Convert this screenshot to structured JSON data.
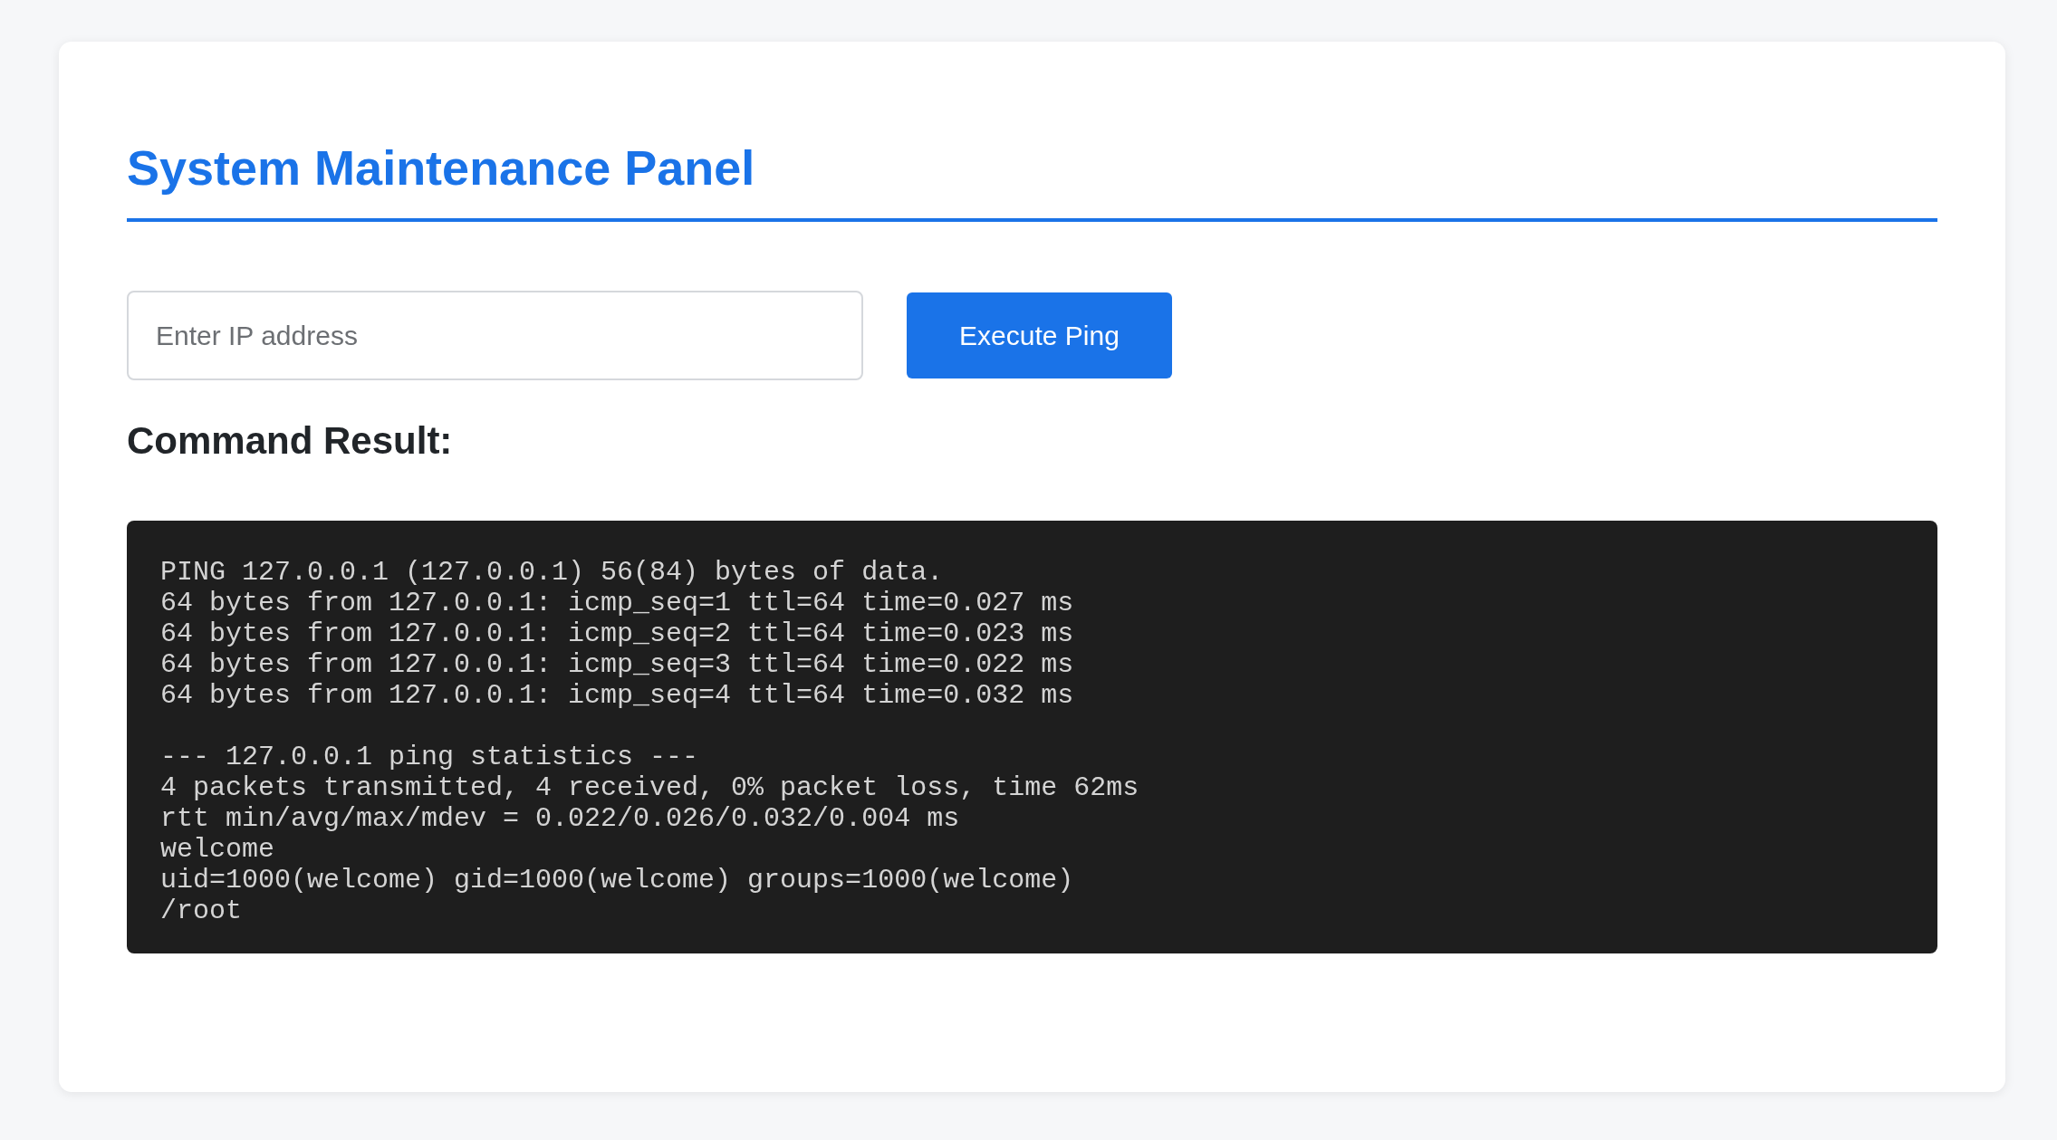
{
  "title": "System Maintenance Panel",
  "ip_field": {
    "placeholder": "Enter IP address"
  },
  "execute_button": "Execute Ping",
  "result_heading": "Command Result:",
  "output_blocks": [
    [
      "PING 127.0.0.1 (127.0.0.1) 56(84) bytes of data.",
      "64 bytes from 127.0.0.1: icmp_seq=1 ttl=64 time=0.027 ms",
      "64 bytes from 127.0.0.1: icmp_seq=2 ttl=64 time=0.023 ms",
      "64 bytes from 127.0.0.1: icmp_seq=3 ttl=64 time=0.022 ms",
      "64 bytes from 127.0.0.1: icmp_seq=4 ttl=64 time=0.032 ms"
    ],
    [
      "--- 127.0.0.1 ping statistics ---",
      "4 packets transmitted, 4 received, 0% packet loss, time 62ms",
      "rtt min/avg/max/mdev = 0.022/0.026/0.032/0.004 ms",
      "welcome",
      "uid=1000(welcome) gid=1000(welcome) groups=1000(welcome)",
      "/root"
    ]
  ]
}
